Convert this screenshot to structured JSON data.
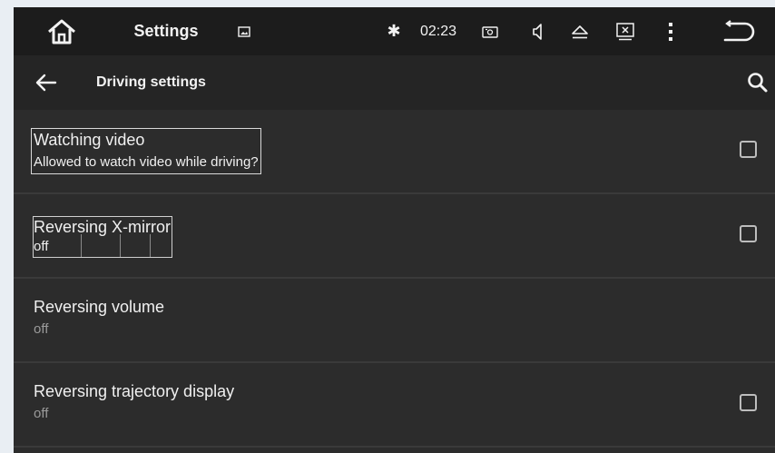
{
  "statusbar": {
    "home_icon": "home-icon",
    "title": "Settings",
    "image_icon": "image-icon",
    "bluetooth_glyph": "✱",
    "time": "02:23",
    "radio_icon": "radio-icon",
    "volume_icon": "volume-icon",
    "eject_icon": "eject-icon",
    "close_box_icon": "close-box-icon",
    "menu_icon": "more-vertical-icon",
    "return_icon": "return-icon"
  },
  "titlebar": {
    "title": "Driving settings",
    "back_icon": "arrow-back-icon",
    "search_icon": "search-icon"
  },
  "settings": [
    {
      "title": "Watching video",
      "summary": "Allowed to watch video while driving?",
      "checked": false
    },
    {
      "title": "Reversing X-mirror",
      "summary": "off",
      "checked": false
    },
    {
      "title": "Reversing volume",
      "summary": "off"
    },
    {
      "title": "Reversing trajectory display",
      "summary": "off",
      "checked": false
    }
  ],
  "colors": {
    "statusbar_bg": "#1c1c1c",
    "titlebar_bg": "#252525",
    "list_bg": "#2c2c2c",
    "divider": "#3a3a3a"
  }
}
